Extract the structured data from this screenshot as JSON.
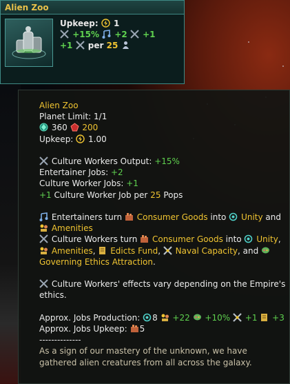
{
  "card": {
    "title": "Alien Zoo",
    "upkeep_label": "Upkeep:",
    "upkeep_value": "1",
    "l2_a": "+15%",
    "l2_b": "+2",
    "l2_c": "+1",
    "l3_a": "+1",
    "l3_b": "per",
    "l3_c": "25"
  },
  "tooltip": {
    "title": "Alien Zoo",
    "planet_limit": "Planet Limit: 1/1",
    "cost_a": "360",
    "cost_b": "200",
    "upkeep_label": "Upkeep:",
    "upkeep_value": "1.00",
    "cw_output_label": "Culture Workers Output:",
    "cw_output_value": "+15%",
    "ent_jobs_label": "Entertainer Jobs:",
    "ent_jobs_value": "+2",
    "cw_jobs_label": "Culture Worker Jobs:",
    "cw_jobs_value": "+1",
    "per_pop_a": "+1",
    "per_pop_b": "Culture Worker Job per",
    "per_pop_c": "25",
    "per_pop_d": "Pops",
    "ent_turn_a": "Entertainers turn",
    "ent_turn_b": "Consumer Goods",
    "ent_turn_c": "into",
    "ent_turn_d": "Unity",
    "ent_turn_e": "and",
    "ent_turn_f": "Amenities",
    "cw_turn_a": "Culture Workers turn",
    "cw_turn_b": "Consumer Goods",
    "cw_turn_c": "into",
    "cw_turn_d": "Unity",
    "cw_turn_e": "Amenities",
    "cw_turn_f": "Edicts Fund",
    "cw_turn_g": "Naval Capacity",
    "cw_turn_h": "and",
    "cw_turn_i": "Governing Ethics Attraction",
    "ethics_note": "Culture Workers' effects vary depending on the Empire's ethics.",
    "prod_label": "Approx. Jobs Production:",
    "prod_a": "8",
    "prod_b": "+22",
    "prod_c": "+10%",
    "prod_d": "+1",
    "prod_e": "+3",
    "jobs_upkeep_label": "Approx. Jobs Upkeep:",
    "jobs_upkeep_value": "5",
    "divider": "--------------",
    "flavor": "As a sign of our mastery of the unknown, we have gathered alien creatures from all across the galaxy."
  },
  "colors": {
    "title_gold": "#e8c14a",
    "highlight_yellow": "#f0c431",
    "positive_green": "#5fd14f",
    "alloy_red": "#e0443c",
    "card_border": "#3f8a86"
  },
  "icons": [
    "energy-icon",
    "entertainer-icon",
    "culture-worker-icon",
    "pop-icon",
    "minerals-icon",
    "alloys-icon",
    "consumer-goods-icon",
    "unity-icon",
    "amenities-icon",
    "edicts-icon",
    "naval-icon",
    "ethics-icon"
  ]
}
